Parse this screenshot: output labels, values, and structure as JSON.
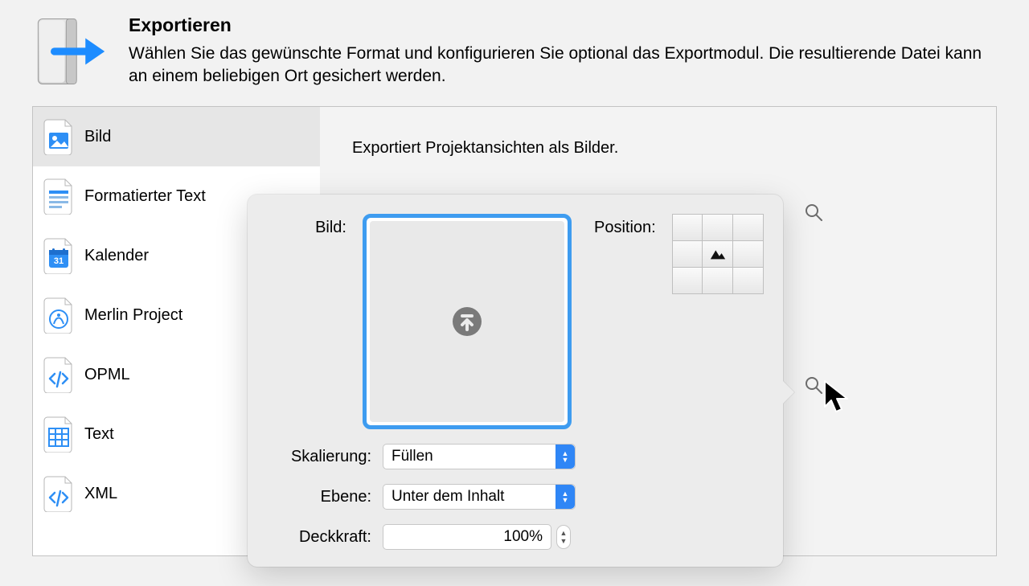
{
  "header": {
    "title": "Exportieren",
    "subtitle": "Wählen Sie das gewünschte Format und konfigurieren Sie optional das Exportmodul. Die resultierende Datei kann an einem beliebigen Ort gesichert werden."
  },
  "sidebar": {
    "items": [
      {
        "label": "Bild",
        "icon": "image",
        "active": true
      },
      {
        "label": "Formatierter Text",
        "icon": "richtext",
        "active": false
      },
      {
        "label": "Kalender",
        "icon": "calendar",
        "active": false
      },
      {
        "label": "Merlin Project",
        "icon": "merlin",
        "active": false
      },
      {
        "label": "OPML",
        "icon": "code",
        "active": false
      },
      {
        "label": "Text",
        "icon": "table",
        "active": false
      },
      {
        "label": "XML",
        "icon": "code",
        "active": false
      }
    ]
  },
  "content": {
    "description": "Exportiert Projektansichten als Bilder."
  },
  "popover": {
    "image_label": "Bild:",
    "position_label": "Position:",
    "selected_position_index": 4,
    "scaling_label": "Skalierung:",
    "scaling_value": "Füllen",
    "layer_label": "Ebene:",
    "layer_value": "Unter dem Inhalt",
    "opacity_label": "Deckkraft:",
    "opacity_value": "100%"
  }
}
